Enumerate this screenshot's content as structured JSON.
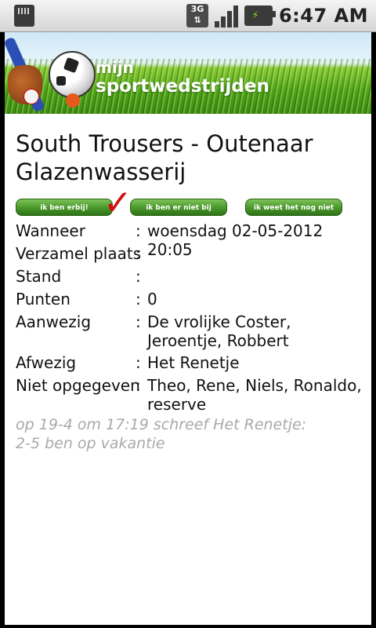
{
  "status_bar": {
    "network_label": "3G",
    "time": "6:47 AM"
  },
  "banner": {
    "logo_line1": "mijn",
    "logo_line2": "sportwedstrijden"
  },
  "match": {
    "title": "South Trousers - Outenaar Glazenwasserij"
  },
  "actions": {
    "attending_label": "ik ben erbij!",
    "not_attending_label": "ik ben er niet bij",
    "unknown_label": "ik weet het nog niet",
    "selected": "attending"
  },
  "details": [
    {
      "label": "Wanneer",
      "value": "woensdag 02-05-2012 20:05"
    },
    {
      "label": "Verzamel plaats",
      "value": ""
    },
    {
      "label": "Stand",
      "value": ""
    },
    {
      "label": "Punten",
      "value": "0"
    },
    {
      "label": "Aanwezig",
      "value": "De vrolijke Coster, Jeroentje, Robbert"
    },
    {
      "label": "Afwezig",
      "value": "Het Renetje"
    },
    {
      "label": "Niet opgegeven",
      "value": "Theo, Rene, Niels, Ronaldo, reserve"
    }
  ],
  "comment": {
    "meta": "op 19-4 om 17:19 schreef Het Renetje:",
    "text": "2-5 ben op vakantie"
  },
  "colors": {
    "accent_green": "#4b9a2c",
    "check_red": "#d10f0f",
    "comment_gray": "#a9a9a9"
  }
}
